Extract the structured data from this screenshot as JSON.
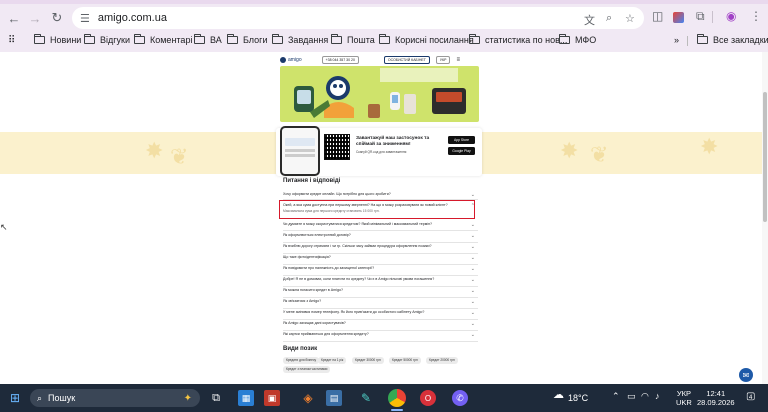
{
  "browser": {
    "url": "amigo.com.ua",
    "nav": {
      "back": "←",
      "forward": "→",
      "reload": "↻"
    },
    "bookmarks": [
      "Новини",
      "Відгуки",
      "Коментарі",
      "ВА",
      "Блоги",
      "Завдання",
      "Пошта",
      "Корисні посилання",
      "статистика по нов...",
      "МФО"
    ],
    "all_bookmarks": "Все закладки",
    "more": "»"
  },
  "site": {
    "header": {
      "logo": "amigo",
      "phone": "+38 044 357 30 20",
      "login_btn": "ОСОБИСТИЙ КАБІНЕТ",
      "lang": "УКР"
    },
    "app_banner": {
      "title": "Завантажуй наш застосунок та спіймай за зниженням!",
      "subtitle": "Скануй QR-код для завантаження",
      "app_store": "App Store",
      "google_play": "Google Play"
    },
    "faq_title": "Питання і відповіді",
    "faq": [
      {
        "q": "Хочу оформити кредит онлайн. Що потрібно для цього зробити?"
      },
      {
        "q": "Окей, а яка сума доступна при першому зверненні? На що я можу розраховувати як новий клієнт?",
        "a": "Максимальна сума для першого кредиту становить 15 000 грн."
      },
      {
        "q": "Чи думаєте я можу скористуватися кредитом? Який мінімальний і максимальний термін?"
      },
      {
        "q": "Як оформлюється електронний договір?"
      },
      {
        "q": "Як вчиблю дорогу отримати і чи гр. Скільки часу займає процедура оформлення позики?"
      },
      {
        "q": "Що таке фотоідентифікація?"
      },
      {
        "q": "Як повідомити про належність до захищеної категорії?"
      },
      {
        "q": "Добре! Я не в домовах, коли платити по кредиту? Чи є в Amigo пільгові умови погашення?"
      },
      {
        "q": "Як можна погасити кредит в Amigo?"
      },
      {
        "q": "Як зв'язатися з Amigo?"
      },
      {
        "q": "У мене змінився номер телефону. Як його прив'язати до особистого кабінету Amigo?"
      },
      {
        "q": "Як Amigo захищає дані користувачів?"
      },
      {
        "q": "Які картки приймаються для оформлення кредиту?"
      }
    ],
    "loan_types_title": "Види позик",
    "loan_types": [
      "Кредити для бізнесу",
      "Кредит на 1 рік",
      "Кредит 30000 грн",
      "Кредит 50000 грн",
      "Кредит 20000 грн",
      "Кредит з планом частинами"
    ]
  },
  "taskbar": {
    "search_placeholder": "Пошук",
    "weather_temp": "18°C",
    "lang_top": "УКР",
    "lang_bottom": "UKR",
    "time": "12:41",
    "date": "28.09.2026",
    "notif_count": "4"
  }
}
